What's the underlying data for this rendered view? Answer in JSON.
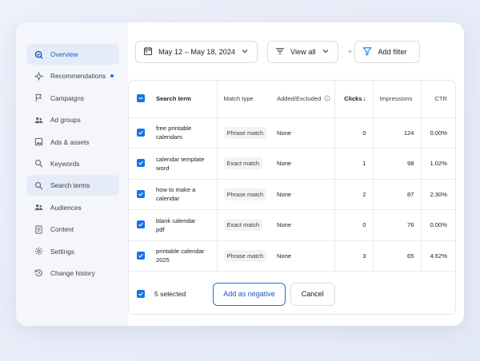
{
  "sidebar": {
    "items": [
      {
        "label": "Overview",
        "icon": "overview-icon"
      },
      {
        "label": "Recommendations",
        "icon": "sparkle-icon"
      },
      {
        "label": "Campaigns",
        "icon": "flag-icon"
      },
      {
        "label": "Ad groups",
        "icon": "people-icon"
      },
      {
        "label": "Ads & assets",
        "icon": "image-icon"
      },
      {
        "label": "Keywords",
        "icon": "search-icon"
      },
      {
        "label": "Search terms",
        "icon": "search-icon"
      },
      {
        "label": "Audiences",
        "icon": "people-icon"
      },
      {
        "label": "Content",
        "icon": "document-icon"
      },
      {
        "label": "Settings",
        "icon": "gear-icon"
      },
      {
        "label": "Change history",
        "icon": "history-icon"
      }
    ]
  },
  "toolbar": {
    "date_range": "May 12 – May 18, 2024",
    "view_all": "View all",
    "plus": "+",
    "add_filter": "Add filter"
  },
  "table": {
    "headers": {
      "term": "Search term",
      "match": "Match type",
      "added": "Added/Excluded",
      "clicks": "Clicks",
      "clicks_sort": "↓",
      "impressions": "Impressions",
      "ctr": "CTR"
    },
    "rows": [
      {
        "term1": "free printable",
        "term2": "calendars",
        "match": "Phrase match",
        "added": "None",
        "clicks": "0",
        "impressions": "124",
        "ctr": "0.00%"
      },
      {
        "term1": "calendar template",
        "term2": "word",
        "match": "Exact match",
        "added": "None",
        "clicks": "1",
        "impressions": "98",
        "ctr": "1.02%"
      },
      {
        "term1": "how to make a",
        "term2": "calendar",
        "match": "Phrase match",
        "added": "None",
        "clicks": "2",
        "impressions": "87",
        "ctr": "2.30%"
      },
      {
        "term1": "blank calendar",
        "term2": "pdf",
        "match": "Exact match",
        "added": "None",
        "clicks": "0",
        "impressions": "76",
        "ctr": "0.00%"
      },
      {
        "term1": "printable calendar",
        "term2": "2025",
        "match": "Phrase match",
        "added": "None",
        "clicks": "3",
        "impressions": "65",
        "ctr": "4.62%"
      }
    ]
  },
  "footer": {
    "selected": "5 selected",
    "add_negative": "Add as negative",
    "cancel": "Cancel"
  },
  "colors": {
    "accent": "#1a73e8",
    "active_nav_bg": "#e6ecf7"
  }
}
